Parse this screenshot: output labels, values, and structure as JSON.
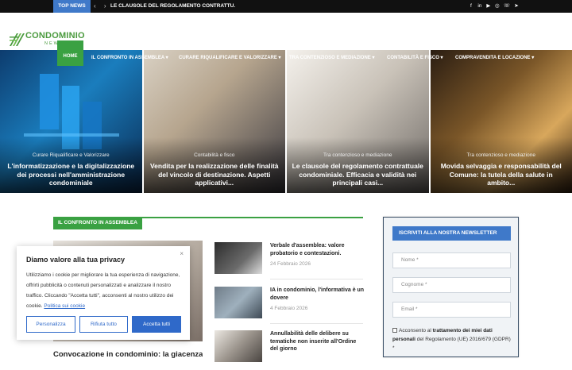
{
  "topbar": {
    "badge": "TOP NEWS",
    "arrows": "‹ ›",
    "ticker": "LE CLAUSOLE DEL REGOLAMENTO CONTRATTU.",
    "social": [
      "f",
      "in",
      "▶",
      "◎",
      "☏",
      "➤"
    ]
  },
  "logo": {
    "name": "CONDOMINIO",
    "sub": "NEWS"
  },
  "nav": {
    "items": [
      "HOME",
      "IL CONFRONTO IN ASSEMBLEA ▾",
      "CURARE RIQUALIFICARE E VALORIZZARE ▾",
      "TRA CONTENZIOSO E MEDIAZIONE ▾",
      "CONTABILITÀ E FISCO ▾",
      "COMPRAVENDITA E LOCAZIONE ▾"
    ]
  },
  "hero": [
    {
      "category": "Curare Riqualificare e Valorizzare",
      "title": "L'informatizzazione e la digitalizzazione dei processi nell'amministrazione condominiale"
    },
    {
      "category": "Contabilità e fisco",
      "title": "Vendita per la realizzazione delle finalità del vincolo di destinazione. Aspetti applicativi..."
    },
    {
      "category": "Tra contenzioso e mediazione",
      "title": "Le clausole del regolamento contrattuale condominiale. Efficacia e validità nei principali casi..."
    },
    {
      "category": "Tra contenzioso e mediazione",
      "title": "Movida selvaggia e responsabilità del Comune: la tutela della salute in ambito..."
    }
  ],
  "section": {
    "label": "IL CONFRONTO IN ASSEMBLEA",
    "feature_title": "Convocazione in condominio: la giacenza"
  },
  "list": [
    {
      "title": "Verbale d'assemblea: valore probatorio e contestazioni.",
      "date": "24 Febbraio 2026"
    },
    {
      "title": "IA in condominio, l'informativa è un dovere",
      "date": "4 Febbraio 2026"
    },
    {
      "title": "Annullabilità delle delibere su tematiche non inserite all'Ordine del giorno",
      "date": ""
    }
  ],
  "newsletter": {
    "heading": "ISCRIVITI ALLA NOSTRA NEWSLETTER",
    "name_placeholder": "Nome *",
    "surname_placeholder": "Cognome *",
    "email_placeholder": "Email *",
    "consent_pre": "Acconsento al ",
    "consent_bold": "trattamento dei miei dati personali",
    "consent_post": " del Regolamento (UE) 2016/679 (GDPR) *"
  },
  "cookie": {
    "close": "×",
    "title": "Diamo valore alla tua privacy",
    "text": "Utilizziamo i cookie per migliorare la tua esperienza di navigazione, offrirti pubblicità o contenuti personalizzati e analizzare il nostro traffico. Cliccando \"Accetta tutti\", acconsenti al nostro utilizzo dei cookie. ",
    "link": "Politica sui cookie",
    "btn_customize": "Personalizza",
    "btn_reject": "Rifiuta tutto",
    "btn_accept": "Accetta tutti"
  }
}
